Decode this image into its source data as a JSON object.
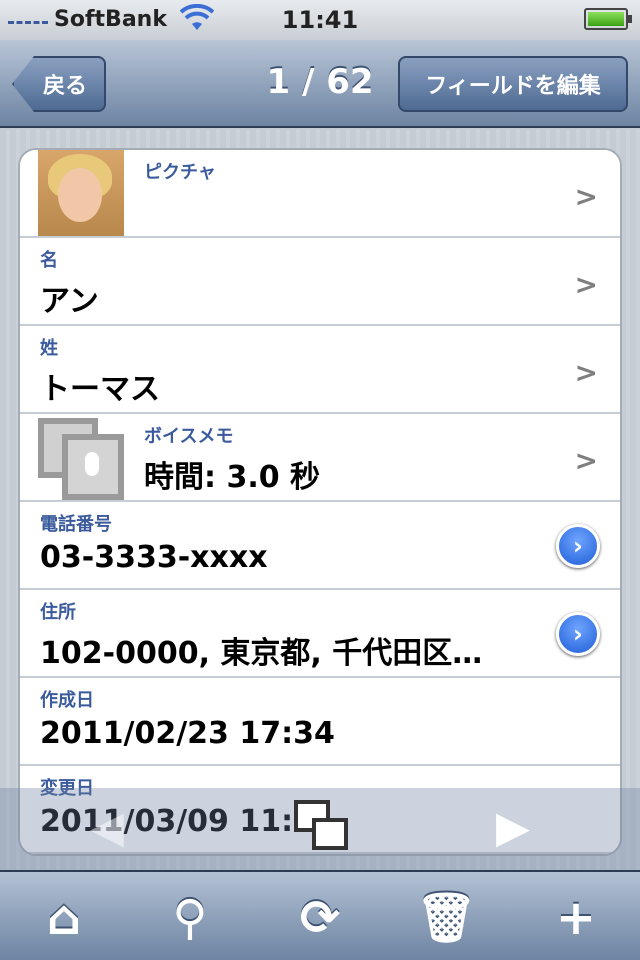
{
  "status_bar": {
    "carrier": "SoftBank",
    "time": "11:41"
  },
  "nav": {
    "back_label": "戻る",
    "title": "1 / 62",
    "edit_label": "フィールドを編集"
  },
  "fields": [
    {
      "label": "ピクチャ",
      "value": "",
      "type": "picture"
    },
    {
      "label": "名",
      "value": "アン",
      "type": "text"
    },
    {
      "label": "姓",
      "value": "トーマス",
      "type": "text"
    },
    {
      "label": "ボイスメモ",
      "value": "時間: 3.0 秒",
      "type": "voice"
    },
    {
      "label": "電話番号",
      "value": "03-3333-xxxx",
      "type": "action"
    },
    {
      "label": "住所",
      "value": "102-0000, 東京都, 千代田区…",
      "type": "action"
    },
    {
      "label": "作成日",
      "value": "2011/02/23 17:34",
      "type": "text"
    },
    {
      "label": "変更日",
      "value": "2011/03/09 11:4",
      "type": "text"
    }
  ],
  "icons": {
    "home": "home-icon",
    "search": "search-icon",
    "sync": "sync-icon",
    "trash": "trash-icon",
    "add": "plus-icon",
    "prev": "arrow-left-icon",
    "next": "arrow-right-icon",
    "duplicate": "duplicate-icon"
  },
  "colors": {
    "nav_bar": "#6d84a3",
    "label_blue": "#3b5b9c",
    "disclosure_blue": "#1e5ed6"
  }
}
